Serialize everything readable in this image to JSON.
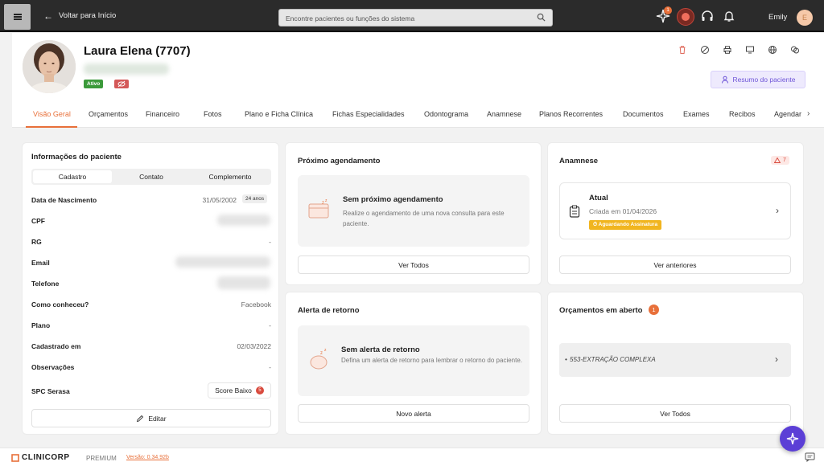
{
  "topbar": {
    "back_label": "Voltar para Início",
    "search_placeholder": "Encontre pacientes ou funções do sistema",
    "notification_count": "1",
    "user_name": "Emily",
    "user_initial": "E"
  },
  "patient": {
    "name": "Laura Elena (7707)",
    "status": "Ativo",
    "summary_button": "Resumo do paciente"
  },
  "tabs": [
    "Visão Geral",
    "Orçamentos",
    "Financeiro",
    "Fotos",
    "Plano e Ficha Clínica",
    "Fichas Especialidades",
    "Odontograma",
    "Anamnese",
    "Planos Recorrentes",
    "Documentos",
    "Exames",
    "Recibos",
    "Agendar"
  ],
  "active_tab": "Visão Geral",
  "info": {
    "title": "Informações do paciente",
    "segments": [
      "Cadastro",
      "Contato",
      "Complemento"
    ],
    "rows": [
      {
        "label": "Data de Nascimento",
        "value": "31/05/2002",
        "chip": "24 anos"
      },
      {
        "label": "CPF",
        "value": ""
      },
      {
        "label": "RG",
        "value": "-"
      },
      {
        "label": "Email",
        "value": ""
      },
      {
        "label": "Telefone",
        "value": ""
      },
      {
        "label": "Como conheceu?",
        "value": "Facebook"
      },
      {
        "label": "Plano",
        "value": "-"
      },
      {
        "label": "Cadastrado em",
        "value": "02/03/2022"
      },
      {
        "label": "Observações",
        "value": "-"
      },
      {
        "label": "SPC Serasa",
        "value": ""
      }
    ],
    "score_label": "Score Baixo",
    "score_value": "5",
    "edit_label": "Editar"
  },
  "proximo": {
    "title": "Próximo agendamento",
    "empty_title": "Sem próximo agendamento",
    "empty_sub": "Realize o agendamento de uma nova consulta para este paciente.",
    "button": "Ver Todos"
  },
  "alerta": {
    "title": "Alerta de retorno",
    "empty_title": "Sem alerta de retorno",
    "empty_sub": "Defina um alerta de retorno para lembrar o retorno do paciente.",
    "button": "Novo alerta"
  },
  "anamnese": {
    "title": "Anamnese",
    "badge": "7",
    "item_title": "Atual",
    "item_sub": "Criada em 01/04/2026",
    "item_status": "Aguardando Assinatura",
    "button": "Ver anteriores"
  },
  "orcamentos": {
    "title": "Orçamentos em aberto",
    "count": "1",
    "item": "553-EXTRAÇÃO COMPLEXA",
    "button": "Ver Todos"
  },
  "footer": {
    "brand": "CLINICORP",
    "plan": "PREMIUM",
    "version": "Versão: 0.34.92b"
  }
}
